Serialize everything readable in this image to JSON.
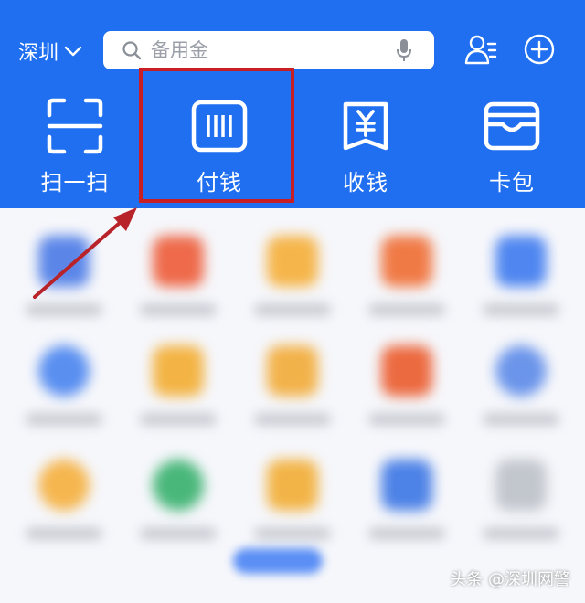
{
  "header": {
    "city": "深圳",
    "search_placeholder": "备用金"
  },
  "features": [
    {
      "label": "扫一扫",
      "icon": "scan-icon"
    },
    {
      "label": "付钱",
      "icon": "barcode-icon"
    },
    {
      "label": "收钱",
      "icon": "yuan-receipt-icon"
    },
    {
      "label": "卡包",
      "icon": "wallet-icon"
    }
  ],
  "watermark": "头条 @深圳网警",
  "colors": {
    "brand_blue": "#1f6ff0",
    "highlight_red": "#c81e24"
  }
}
